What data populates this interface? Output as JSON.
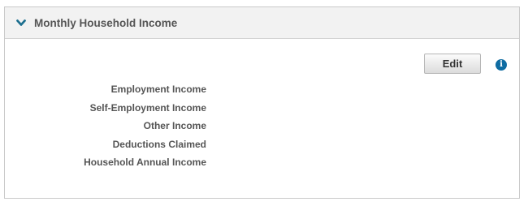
{
  "section": {
    "title": "Monthly Household Income",
    "expand_icon": "chevron-down-icon",
    "accent_color": "#1d6f8f"
  },
  "actions": {
    "edit_label": "Edit",
    "info_icon": "info-icon",
    "info_glyph": "i",
    "info_color": "#0f6ca2"
  },
  "fields": [
    {
      "label": "Employment Income"
    },
    {
      "label": "Self-Employment Income"
    },
    {
      "label": "Other Income"
    },
    {
      "label": "Deductions Claimed"
    },
    {
      "label": "Household Annual Income"
    }
  ]
}
